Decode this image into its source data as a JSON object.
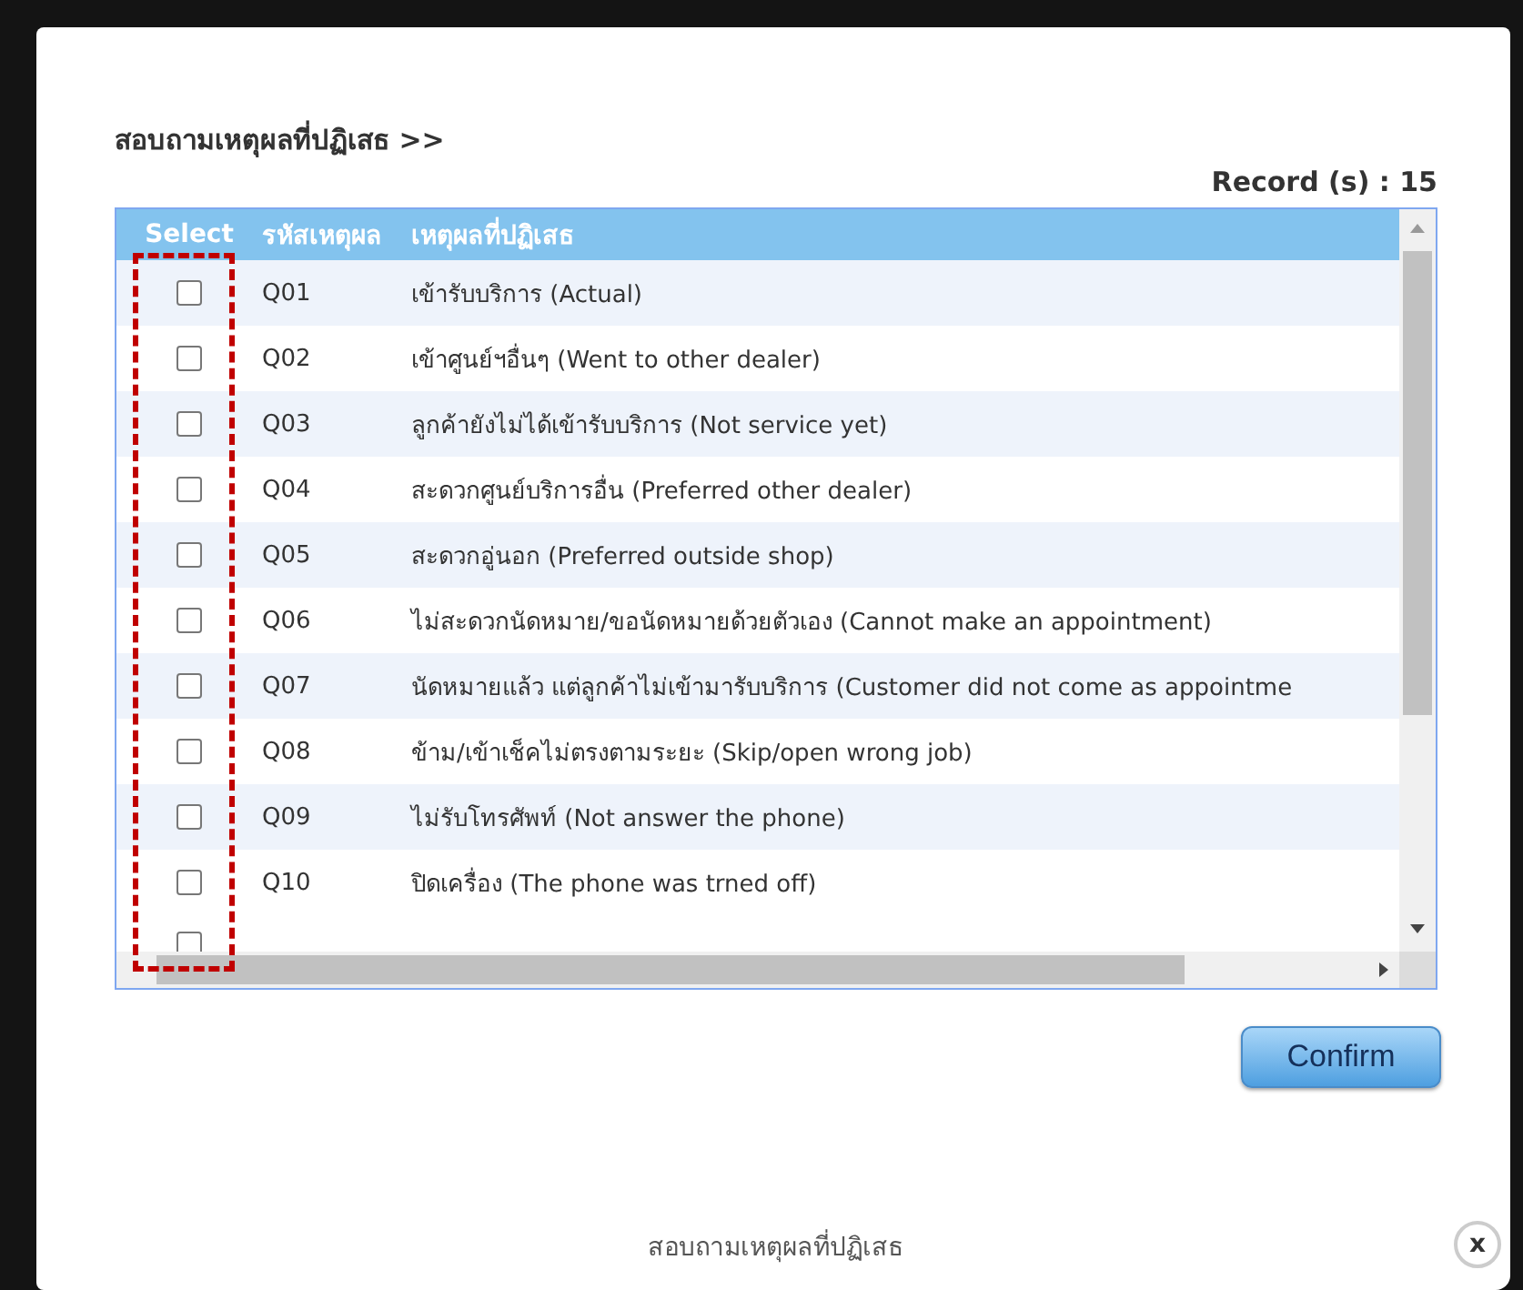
{
  "dialog": {
    "heading": "สอบถามเหตุผลที่ปฏิเสธ >>",
    "record_count": "Record (s) : 15",
    "table": {
      "columns": [
        "Select",
        "รหัสเหตุผล",
        "เหตุผลที่ปฏิเสธ"
      ],
      "rows": [
        {
          "checked": false,
          "code": "Q01",
          "reason": "เข้ารับบริการ (Actual)"
        },
        {
          "checked": false,
          "code": "Q02",
          "reason": "เข้าศูนย์ฯอื่นๆ (Went to other dealer)"
        },
        {
          "checked": false,
          "code": "Q03",
          "reason": "ลูกค้ายังไม่ได้เข้ารับบริการ (Not service yet)"
        },
        {
          "checked": false,
          "code": "Q04",
          "reason": "สะดวกศูนย์บริการอื่น (Preferred other dealer)"
        },
        {
          "checked": false,
          "code": "Q05",
          "reason": "สะดวกอู่นอก (Preferred outside shop)"
        },
        {
          "checked": false,
          "code": "Q06",
          "reason": "ไม่สะดวกนัดหมาย/ขอนัดหมายด้วยตัวเอง (Cannot make an appointment)"
        },
        {
          "checked": false,
          "code": "Q07",
          "reason": "นัดหมายแล้ว แต่ลูกค้าไม่เข้ามารับบริการ (Customer did not come as appointme"
        },
        {
          "checked": false,
          "code": "Q08",
          "reason": "ข้าม/เข้าเช็คไม่ตรงตามระยะ (Skip/open wrong job)"
        },
        {
          "checked": false,
          "code": "Q09",
          "reason": "ไม่รับโทรศัพท์ (Not answer the phone)"
        },
        {
          "checked": false,
          "code": "Q10",
          "reason": "ปิดเครื่อง (The phone was trned off)"
        }
      ],
      "partial_row": {
        "checked": false
      }
    },
    "confirm_button": "Confirm",
    "footer": "สอบถามเหตุผลที่ปฏิเสธ",
    "close_button": "x"
  }
}
